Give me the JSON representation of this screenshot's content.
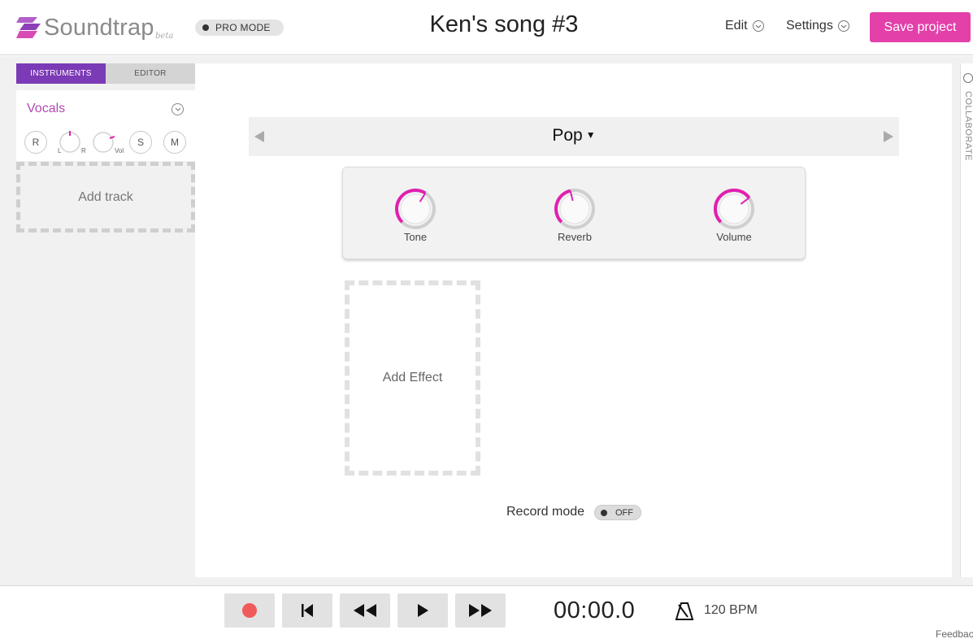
{
  "header": {
    "logo_text": "Soundtrap",
    "logo_beta": "beta",
    "pro_mode_label": "PRO MODE",
    "song_title": "Ken's song #3",
    "edit_menu": "Edit",
    "settings_menu": "Settings",
    "save_button": "Save project"
  },
  "left_panel": {
    "tabs": [
      {
        "label": "INSTRUMENTS",
        "active": true
      },
      {
        "label": "EDITOR",
        "active": false
      }
    ],
    "track": {
      "name": "Vocals",
      "record_label": "R",
      "pan_left_label": "L",
      "pan_right_label": "R",
      "volume_label": "Vol",
      "solo_label": "S",
      "mute_label": "M"
    },
    "add_track_label": "Add track"
  },
  "main": {
    "preset": "Pop",
    "effects": [
      {
        "label": "Tone",
        "level": 0.62
      },
      {
        "label": "Reverb",
        "level": 0.45
      },
      {
        "label": "Volume",
        "level": 0.7
      }
    ],
    "add_effect_label": "Add Effect",
    "record_mode_label": "Record mode",
    "record_mode_state": "OFF"
  },
  "sidebar_right": {
    "collaborate_label": "COLLABORATE"
  },
  "transport": {
    "time": "00:00.0",
    "bpm": "120 BPM",
    "feedback": "Feedback"
  },
  "colors": {
    "accent_pink": "#e340a9",
    "accent_purple": "#7b3ab6",
    "knob_pink": "#e020b0",
    "record_red": "#f05a5a"
  },
  "icons": {
    "logo": "soundtrap-logo-icon",
    "record": "record-icon",
    "to_start": "skip-to-start-icon",
    "rewind": "rewind-icon",
    "play": "play-icon",
    "fast_forward": "fast-forward-icon",
    "metronome": "metronome-icon"
  }
}
